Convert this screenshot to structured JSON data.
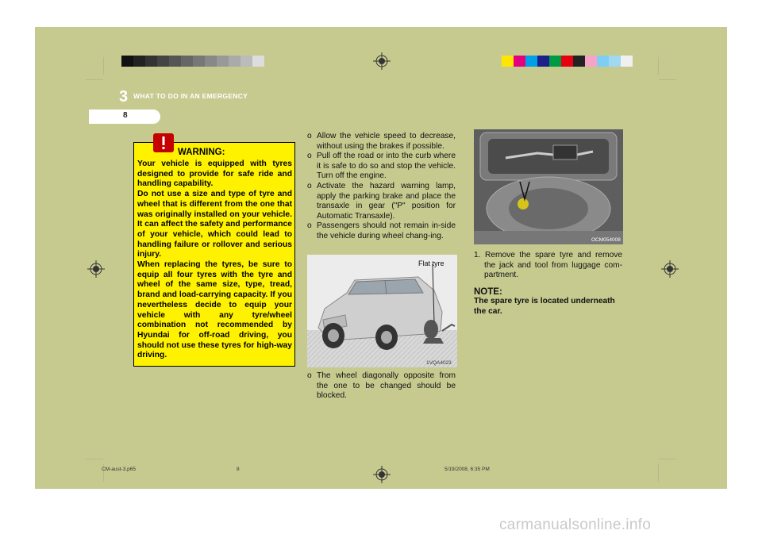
{
  "header": {
    "chapter_number": "3",
    "chapter_title": "WHAT TO DO IN AN EMERGENCY",
    "page_number": "8"
  },
  "warning": {
    "title": "WARNING:",
    "paragraphs": [
      "Your vehicle is equipped with tyres designed to provide for safe ride and handling capability.",
      "Do not use a size and type of tyre and wheel that is different from the one that was originally installed on your vehicle. It can affect the safety and performance of your vehicle, which could lead to handling failure or rollover and serious injury.",
      "When replacing the tyres, be sure to equip all four tyres with the tyre and wheel of the same size, type, tread, brand and load-carrying capacity. If you nevertheless decide to equip your vehicle with any tyre/wheel combination not recommended by Hyundai for off-road driving, you should not use these tyres for high-way driving."
    ]
  },
  "middle": {
    "bullets": [
      "Allow the vehicle speed to decrease, without using the brakes if possible.",
      "Pull off the road or into the curb where it is safe to do so and stop the vehicle. Turn off the engine.",
      "Activate the hazard warning lamp, apply the parking brake and place the transaxle in gear (\"P\" position for Automatic Transaxle).",
      "Passengers should not remain in-side the vehicle during wheel chang-ing."
    ],
    "figure_label": "Flat tyre",
    "figure_code": "1VQA4023",
    "after_bullet": "The wheel diagonally opposite from the one to be changed should be blocked."
  },
  "right": {
    "figure_code": "OCM054008",
    "step": "1. Remove the spare tyre and remove the jack and tool from luggage com-partment.",
    "note_title": "NOTE:",
    "note_body": "The spare tyre is located underneath the car."
  },
  "footer": {
    "file": "CM-aust-3.p65",
    "page": "8",
    "timestamp": "5/19/2008, 6:35 PM"
  },
  "watermark": "carmanualsonline.info",
  "colors": {
    "background": "#c6ca8f",
    "warning_box": "#fff200"
  }
}
